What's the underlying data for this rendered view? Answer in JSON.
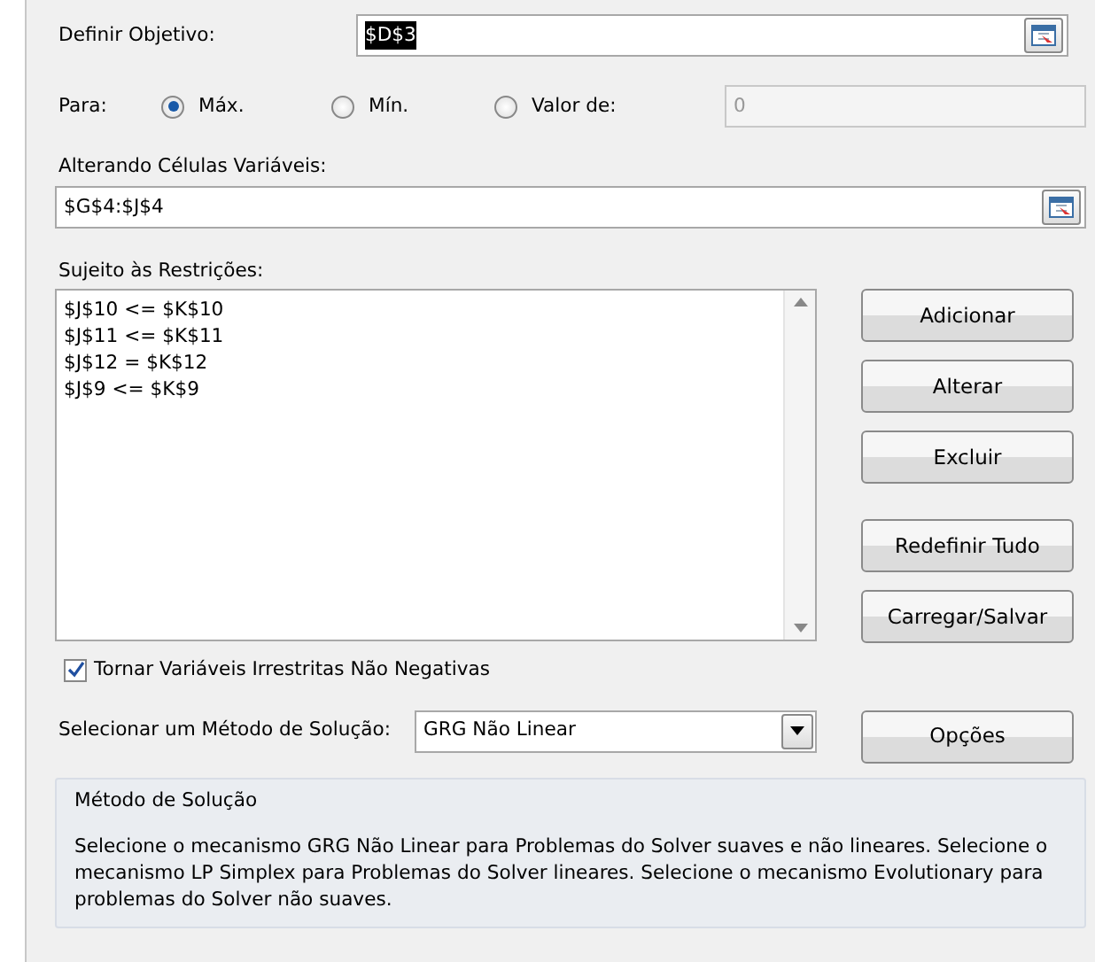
{
  "objective": {
    "label": "Definir Objetivo:",
    "value": "$D$3",
    "selected": true
  },
  "target": {
    "label": "Para:",
    "options": [
      {
        "label": "Máx.",
        "selected": true
      },
      {
        "label": "Mín.",
        "selected": false
      },
      {
        "label": "Valor de:",
        "selected": false
      }
    ],
    "value": "0",
    "disabled": true
  },
  "variables": {
    "label": "Alterando Células Variáveis:",
    "value": "$G$4:$J$4"
  },
  "constraints": {
    "label": "Sujeito às Restrições:",
    "items": [
      "$J$10 <= $K$10",
      "$J$11 <= $K$11",
      "$J$12 = $K$12",
      "$J$9 <= $K$9"
    ]
  },
  "button_groups": [
    [
      "Adicionar",
      "Alterar",
      "Excluir"
    ],
    [
      "Redefinir Tudo",
      "Carregar/Salvar"
    ]
  ],
  "nonnegative": {
    "label": "Tornar Variáveis Irrestritas Não Negativas",
    "checked": true
  },
  "method": {
    "label": "Selecionar um Método de Solução:",
    "value": "GRG Não Linear",
    "options_button": "Opções"
  },
  "info": {
    "title": "Método de Solução",
    "text": "Selecione o mecanismo GRG Não Linear para Problemas do Solver suaves e não lineares. Selecione o mecanismo LP Simplex para Problemas do Solver lineares. Selecione o mecanismo Evolutionary para problemas do Solver não suaves."
  }
}
